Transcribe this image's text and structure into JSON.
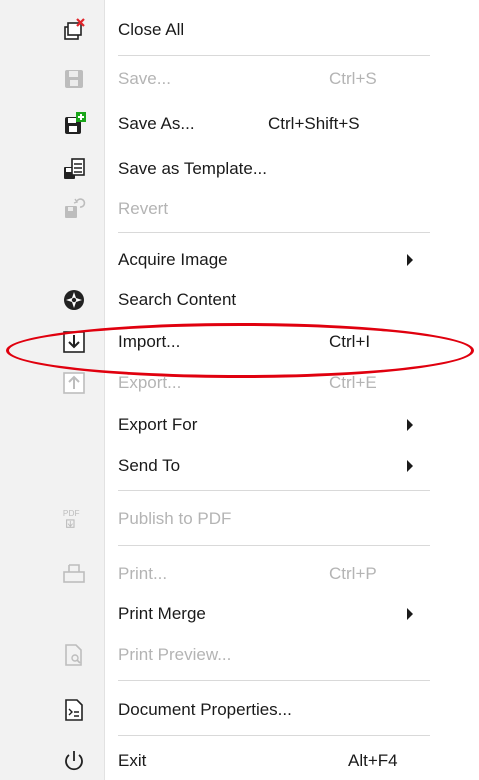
{
  "menu": {
    "close_all": {
      "label": "Close All",
      "icon": "close-all-icon"
    },
    "save": {
      "label": "Save...",
      "shortcut": "Ctrl+S",
      "icon": "save-icon",
      "enabled": false
    },
    "save_as": {
      "label": "Save As...",
      "shortcut": "Ctrl+Shift+S",
      "icon": "save-as-icon",
      "enabled": true
    },
    "save_template": {
      "label": "Save as Template...",
      "icon": "save-template-icon"
    },
    "revert": {
      "label": "Revert",
      "icon": "revert-icon",
      "enabled": false
    },
    "acquire_image": {
      "label": "Acquire Image",
      "submenu": true
    },
    "search_content": {
      "label": "Search Content",
      "icon": "search-content-icon"
    },
    "import": {
      "label": "Import...",
      "shortcut": "Ctrl+I",
      "icon": "import-icon",
      "highlighted": true
    },
    "export": {
      "label": "Export...",
      "shortcut": "Ctrl+E",
      "icon": "export-icon",
      "enabled": false
    },
    "export_for": {
      "label": "Export For",
      "submenu": true
    },
    "send_to": {
      "label": "Send To",
      "submenu": true
    },
    "publish_pdf": {
      "label": "Publish to PDF",
      "icon": "pdf-icon",
      "enabled": false
    },
    "print": {
      "label": "Print...",
      "shortcut": "Ctrl+P",
      "icon": "print-icon",
      "enabled": false
    },
    "print_merge": {
      "label": "Print Merge",
      "submenu": true
    },
    "print_preview": {
      "label": "Print Preview...",
      "icon": "print-preview-icon",
      "enabled": false
    },
    "doc_props": {
      "label": "Document Properties...",
      "icon": "document-properties-icon"
    },
    "exit": {
      "label": "Exit",
      "shortcut": "Alt+F4",
      "icon": "power-icon"
    }
  },
  "pdf_icon_text": "PDF",
  "colors": {
    "highlight_ring": "#e0000e",
    "disabled_text": "#b4b4b4",
    "gutter": "#f2f2f2",
    "green_badge": "#1aa51a",
    "red_badge": "#e0242a"
  }
}
